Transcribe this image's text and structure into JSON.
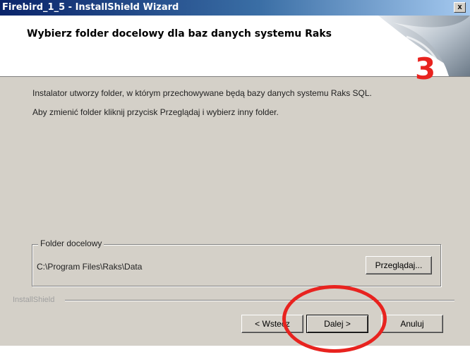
{
  "window": {
    "title": "Firebird_1_5 - InstallShield Wizard",
    "close_label": "x"
  },
  "header": {
    "title": "Wybierz folder docelowy dla baz danych systemu Raks",
    "step_number": "3"
  },
  "body": {
    "line1": "Instalator utworzy folder, w którym przechowywane będą bazy danych systemu Raks SQL.",
    "line2": "Aby zmienić folder kliknij przycisk Przeglądaj i wybierz inny folder."
  },
  "destination": {
    "group_label": "Folder docelowy",
    "path": "C:\\Program Files\\Raks\\Data",
    "browse_label": "Przeglądaj..."
  },
  "footer": {
    "brand": "InstallShield",
    "back_label": "< Wstecz",
    "next_label": "Dalej >",
    "cancel_label": "Anuluj"
  },
  "colors": {
    "annotation": "#e8231f"
  }
}
